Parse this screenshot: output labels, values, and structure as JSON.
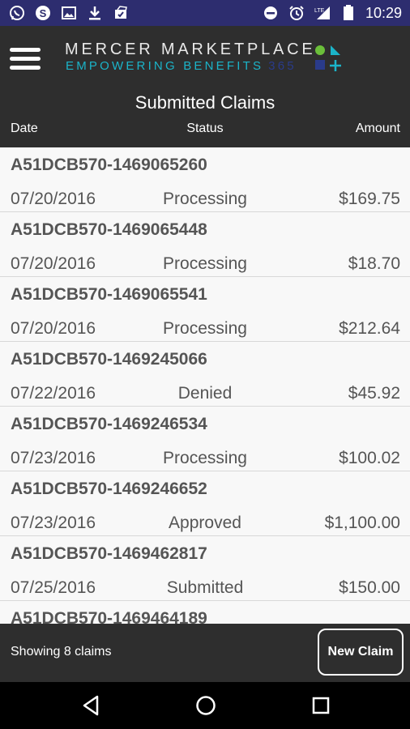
{
  "status_bar": {
    "time": "10:29",
    "left_icons": [
      "whatsapp-icon",
      "skype-icon",
      "image-icon",
      "download-icon",
      "sync-icon"
    ],
    "right_icons": [
      "do-not-disturb-icon",
      "alarm-icon",
      "signal-lte-icon",
      "battery-icon"
    ],
    "network_label": "LTE"
  },
  "header": {
    "brand_title": "MERCER MARKETPLACE",
    "brand_tagline": "EMPOWERING BENEFITS",
    "brand_tagline_number": "365",
    "page_title": "Submitted Claims",
    "columns": {
      "date": "Date",
      "status": "Status",
      "amount": "Amount"
    },
    "logo_colors": [
      "#6bbf3a",
      "#1bb4c9",
      "#2a3b8a",
      "#1bb4c9"
    ]
  },
  "claims": [
    {
      "id": "A51DCB570-1469065260",
      "date": "07/20/2016",
      "status": "Processing",
      "amount": "$169.75"
    },
    {
      "id": "A51DCB570-1469065448",
      "date": "07/20/2016",
      "status": "Processing",
      "amount": "$18.70"
    },
    {
      "id": "A51DCB570-1469065541",
      "date": "07/20/2016",
      "status": "Processing",
      "amount": "$212.64"
    },
    {
      "id": "A51DCB570-1469245066",
      "date": "07/22/2016",
      "status": "Denied",
      "amount": "$45.92"
    },
    {
      "id": "A51DCB570-1469246534",
      "date": "07/23/2016",
      "status": "Processing",
      "amount": "$100.02"
    },
    {
      "id": "A51DCB570-1469246652",
      "date": "07/23/2016",
      "status": "Approved",
      "amount": "$1,100.00"
    },
    {
      "id": "A51DCB570-1469462817",
      "date": "07/25/2016",
      "status": "Submitted",
      "amount": "$150.00"
    },
    {
      "id": "A51DCB570-1469464189",
      "date": "",
      "status": "",
      "amount": ""
    }
  ],
  "footer": {
    "count_label": "Showing 8 claims",
    "new_claim_label": "New Claim"
  },
  "nav_bar": {
    "buttons": [
      "back-icon",
      "home-icon",
      "recents-icon"
    ]
  },
  "colors": {
    "status_bar": "#2d2d6f",
    "header": "#2e2e2e",
    "accent": "#1bb4c9",
    "list_bg": "#f8f8f8",
    "text": "#555555"
  }
}
